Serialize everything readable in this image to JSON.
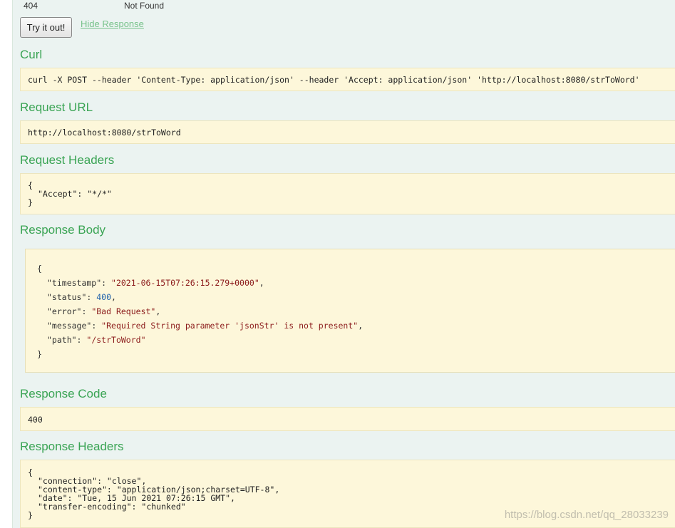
{
  "status_row": {
    "code": "404",
    "reason": "Not Found"
  },
  "actions": {
    "try_label": "Try it out!",
    "hide_label": "Hide Response"
  },
  "curl": {
    "heading": "Curl",
    "command": "curl -X POST --header 'Content-Type: application/json' --header 'Accept: application/json' 'http://localhost:8080/strToWord'"
  },
  "request_url": {
    "heading": "Request URL",
    "value": "http://localhost:8080/strToWord"
  },
  "request_headers": {
    "heading": "Request Headers",
    "open": "{",
    "line": "\"Accept\": \"*/*\"",
    "close": "}"
  },
  "response_body": {
    "heading": "Response Body",
    "open": "{",
    "close": "}",
    "fields": [
      {
        "key": "\"timestamp\"",
        "value": "\"2021-06-15T07:26:15.279+0000\"",
        "type": "string",
        "comma": ","
      },
      {
        "key": "\"status\"",
        "value": "400",
        "type": "number",
        "comma": ","
      },
      {
        "key": "\"error\"",
        "value": "\"Bad Request\"",
        "type": "string",
        "comma": ","
      },
      {
        "key": "\"message\"",
        "value": "\"Required String parameter 'jsonStr' is not present\"",
        "type": "string",
        "comma": ","
      },
      {
        "key": "\"path\"",
        "value": "\"/strToWord\"",
        "type": "string",
        "comma": ""
      }
    ]
  },
  "response_code": {
    "heading": "Response Code",
    "value": "400"
  },
  "response_headers": {
    "heading": "Response Headers",
    "open": "{",
    "lines": [
      "\"connection\": \"close\",",
      "\"content-type\": \"application/json;charset=UTF-8\",",
      "\"date\": \"Tue, 15 Jun 2021 07:26:15 GMT\",",
      "\"transfer-encoding\": \"chunked\""
    ],
    "close": "}"
  },
  "watermark": "https://blog.csdn.net/qq_28033239"
}
